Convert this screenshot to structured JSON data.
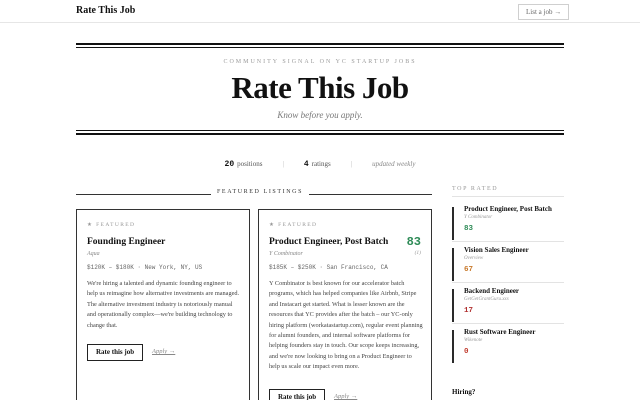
{
  "nav": {
    "brand": "Rate This Job",
    "list_job": "List a job →"
  },
  "masthead": {
    "kicker": "COMMUNITY SIGNAL ON YC STARTUP JOBS",
    "title": "Rate This Job",
    "tagline": "Know before you apply."
  },
  "stats": {
    "positions_num": "20",
    "positions_label": "positions",
    "ratings_num": "4",
    "ratings_label": "ratings",
    "updated": "updated weekly"
  },
  "featured": {
    "header": "FEATURED LISTINGS",
    "cards": [
      {
        "badge": "★ FEATURED",
        "title": "Founding Engineer",
        "company": "Aqua",
        "meta": "$120K – $180K · New York, NY, US",
        "desc": "We're hiring a talented and dynamic founding engineer to help us reimagine how alternative investments are managed. The alternative investment industry is notoriously manual and operationally complex—we're building technology to change that.",
        "rate_label": "Rate this job",
        "apply_label": "Apply →"
      },
      {
        "badge": "★ FEATURED",
        "title": "Product Engineer, Post Batch",
        "company": "Y Combinator",
        "meta": "$185K – $250K · San Francisco, CA",
        "score": "83",
        "score_count": "(1)",
        "desc": "Y Combinator is best known for our accelerator batch programs, which has helped companies like Airbnb, Stripe and Instacart get started. What is lesser known are the resources that YC provides after the batch – our YC-only hiring platform (workatastartup.com), regular event planning for alumni founders, and internal software platforms for helping founders stay in touch. Our scope keeps increasing, and we're now looking to bring on a Product Engineer to help us scale our impact even more.",
        "rate_label": "Rate this job",
        "apply_label": "Apply →"
      }
    ]
  },
  "sidebar": {
    "header": "TOP RATED",
    "items": [
      {
        "title": "Product Engineer, Post Batch",
        "company": "Y Combinator",
        "score": "83",
        "color": "#2e8b57"
      },
      {
        "title": "Vision Sales Engineer",
        "company": "Overview",
        "score": "67",
        "color": "#c8782a"
      },
      {
        "title": "Backend Engineer",
        "company": "GetGetGrantGuru.xxx",
        "score": "17",
        "color": "#b03030"
      },
      {
        "title": "Rust Software Engineer",
        "company": "Wikenote",
        "score": "0",
        "color": "#c0392b"
      }
    ],
    "hiring": "Hiring?"
  }
}
